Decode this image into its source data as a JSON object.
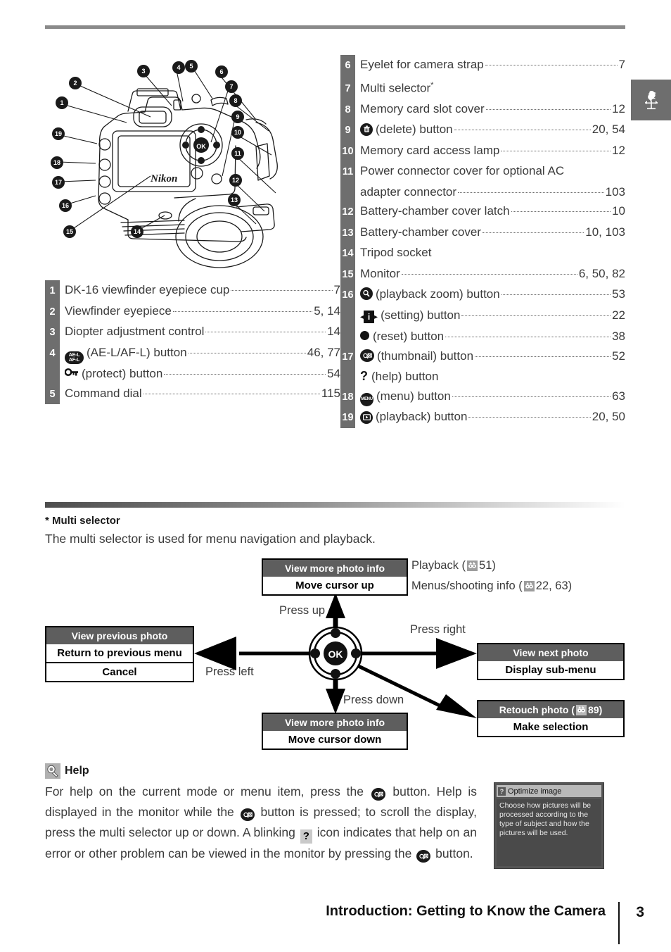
{
  "page": {
    "number": "3",
    "footer_title": "Introduction: Getting to Know the Camera",
    "tab_icon": "weathervane-rooster-icon"
  },
  "figure": {
    "name": "camera-rear-three-quarter-line-drawing",
    "brand_text": "Nikon",
    "ok_text": "OK",
    "callout_numbers": [
      "1",
      "2",
      "3",
      "4",
      "5",
      "6",
      "7",
      "8",
      "9",
      "10",
      "11",
      "12",
      "13",
      "14",
      "15",
      "16",
      "17",
      "18",
      "19"
    ]
  },
  "parts_left": [
    {
      "num": "1",
      "icon": "",
      "label": "DK-16 viewfinder eyepiece cup",
      "page": "7"
    },
    {
      "num": "2",
      "icon": "",
      "label": "Viewfinder eyepiece",
      "page": "5, 14"
    },
    {
      "num": "3",
      "icon": "",
      "label": "Diopter adjustment control",
      "page": "14"
    },
    {
      "num": "4",
      "icon": "ae-l-af-l-button-icon",
      "label": "(AE-L/AF-L) button",
      "page": "46, 77"
    },
    {
      "num": "",
      "icon": "protect-key-icon",
      "label": "(protect) button",
      "page": "54"
    },
    {
      "num": "5",
      "icon": "",
      "label": "Command dial",
      "page": "115"
    }
  ],
  "parts_right": [
    {
      "num": "6",
      "icon": "",
      "label": "Eyelet for camera strap",
      "page": "7"
    },
    {
      "num": "7",
      "icon": "",
      "label": "Multi selector",
      "page": "",
      "superscript": "*"
    },
    {
      "num": "8",
      "icon": "",
      "label": "Memory card slot cover",
      "page": "12"
    },
    {
      "num": "9",
      "icon": "trash-delete-icon",
      "label": "(delete) button",
      "page": "20, 54"
    },
    {
      "num": "10",
      "icon": "",
      "label": "Memory card access lamp",
      "page": "12"
    },
    {
      "num": "11",
      "icon": "",
      "label": "Power connector cover for optional AC",
      "page": ""
    },
    {
      "num": "",
      "icon": "",
      "label": "adapter connector",
      "page": "103"
    },
    {
      "num": "12",
      "icon": "",
      "label": "Battery-chamber cover latch",
      "page": "10"
    },
    {
      "num": "13",
      "icon": "",
      "label": "Battery-chamber cover",
      "page": "10, 103"
    },
    {
      "num": "14",
      "icon": "",
      "label": "Tripod socket",
      "page": ""
    },
    {
      "num": "15",
      "icon": "",
      "label": "Monitor",
      "page": "6, 50, 82"
    },
    {
      "num": "16",
      "icon": "playback-zoom-magnifier-icon",
      "label": "(playback zoom) button",
      "page": "53"
    },
    {
      "num": "",
      "icon": "setting-info-icon",
      "label": "(setting) button",
      "page": "22"
    },
    {
      "num": "",
      "icon": "reset-dot-icon",
      "label": "(reset) button",
      "page": "38"
    },
    {
      "num": "17",
      "icon": "thumbnail-icon",
      "label": "(thumbnail) button",
      "page": "52"
    },
    {
      "num": "",
      "icon": "help-question-icon",
      "label": "(help) button",
      "page": ""
    },
    {
      "num": "18",
      "icon": "menu-button-icon",
      "label": "(menu) button",
      "page": "63"
    },
    {
      "num": "19",
      "icon": "playback-button-icon",
      "label": "(playback) button",
      "page": "20, 50"
    }
  ],
  "multi_selector": {
    "heading": "* Multi selector",
    "intro": "The multi selector is used for menu navigation and playback.",
    "ok_label": "OK",
    "up": {
      "header": "View more photo info",
      "rows": [
        "Move cursor up"
      ],
      "press_label": "Press up"
    },
    "down": {
      "header": "View more photo info",
      "rows": [
        "Move cursor down"
      ],
      "press_label": "Press down"
    },
    "left": {
      "header": "View previous photo",
      "rows": [
        "Return to previous menu",
        "Cancel"
      ],
      "press_label": "Press left"
    },
    "right": {
      "header": "View next photo",
      "rows": [
        "Display sub-menu"
      ],
      "press_label": "Press right"
    },
    "retouch": {
      "header_prefix": "Retouch photo (",
      "header_page": "89",
      "header_suffix": ")",
      "rows": [
        "Make selection"
      ]
    },
    "side_notes": [
      {
        "prefix": "Playback (",
        "page": "51",
        "suffix": ")"
      },
      {
        "prefix": "Menus/shooting info (",
        "page": "22, 63",
        "suffix": ")"
      }
    ]
  },
  "help": {
    "title": "Help",
    "icon": "help-magnifier-icon",
    "text_1": "For help on the current mode or menu item, press the",
    "text_2": "button.  Help is displayed in the monitor while the",
    "text_3": "button is pressed; to scroll the display, press the multi selector up or down.  A blinking",
    "q_glyph": "?",
    "text_4": "icon indicates that help on an error or other problem can be viewed in the monitor by pressing the",
    "text_5": "button."
  },
  "lcd": {
    "q_glyph": "?",
    "title": "Optimize image",
    "body": "Choose how pictures will be processed according to the type of subject and how the pictures will be used."
  },
  "colors": {
    "number_bar": "#6e6e6e",
    "callout_header": "#5e5e5e",
    "rule": "#8a8a8a",
    "tab": "#6e6e6e",
    "text": "#3b3b3b"
  }
}
